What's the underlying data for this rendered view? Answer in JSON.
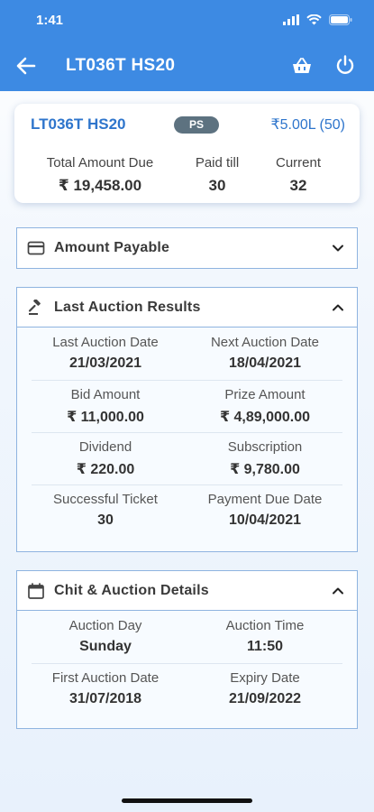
{
  "status": {
    "time": "1:41"
  },
  "header": {
    "title": "LT036T HS20"
  },
  "summary": {
    "ticket": "LT036T HS20",
    "badge": "PS",
    "amount": "₹5.00L (50)",
    "total_due_label": "Total Amount Due",
    "total_due_value": "₹ 19,458.00",
    "paid_till_label": "Paid till",
    "paid_till_value": "30",
    "current_label": "Current",
    "current_value": "32"
  },
  "amount_payable": {
    "title": "Amount Payable",
    "icon": "card-icon",
    "expanded": false
  },
  "auction_results": {
    "title": "Last Auction Results",
    "icon": "gavel-icon",
    "expanded": true,
    "rows": [
      [
        {
          "label": "Last Auction Date",
          "value": "21/03/2021"
        },
        {
          "label": "Next Auction Date",
          "value": "18/04/2021"
        }
      ],
      [
        {
          "label": "Bid Amount",
          "value": "₹ 11,000.00"
        },
        {
          "label": "Prize Amount",
          "value": "₹ 4,89,000.00"
        }
      ],
      [
        {
          "label": "Dividend",
          "value": "₹ 220.00"
        },
        {
          "label": "Subscription",
          "value": "₹ 9,780.00"
        }
      ],
      [
        {
          "label": "Successful Ticket",
          "value": "30"
        },
        {
          "label": "Payment Due Date",
          "value": "10/04/2021"
        }
      ]
    ]
  },
  "chit_details": {
    "title": "Chit & Auction Details",
    "icon": "calendar-icon",
    "expanded": true,
    "rows": [
      [
        {
          "label": "Auction Day",
          "value": "Sunday"
        },
        {
          "label": "Auction Time",
          "value": "11:50"
        }
      ],
      [
        {
          "label": "First Auction Date",
          "value": "31/07/2018"
        },
        {
          "label": "Expiry Date",
          "value": "21/09/2022"
        }
      ]
    ]
  },
  "colors": {
    "primary": "#3d8ae3",
    "link": "#2e75cc",
    "badge": "#5d7280",
    "border": "#8fb4e0"
  }
}
